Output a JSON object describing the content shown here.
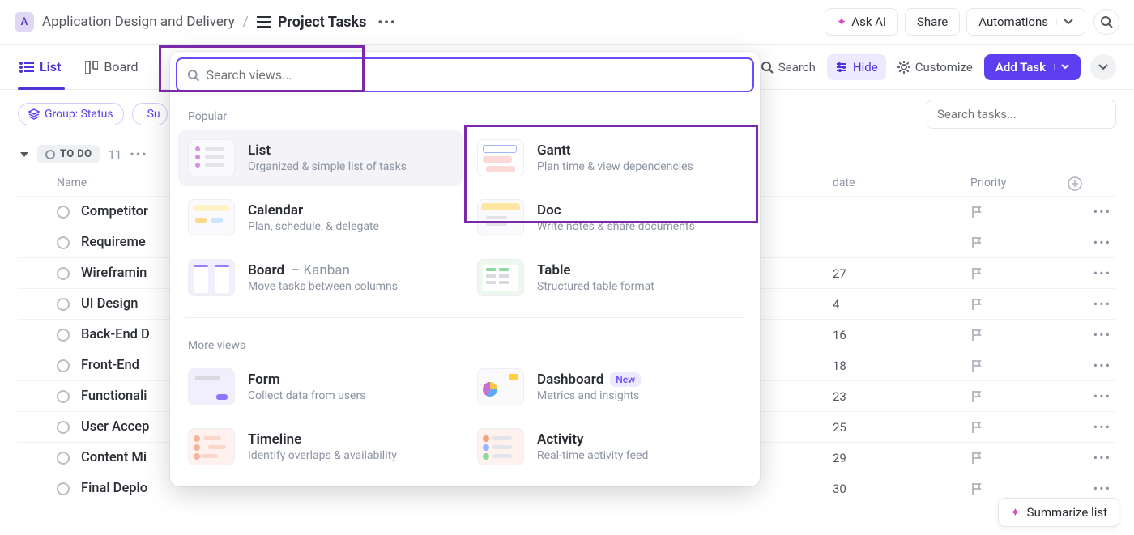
{
  "header": {
    "workspace_badge": "A",
    "folder": "Application Design and Delivery",
    "title": "Project Tasks",
    "ask_ai": "Ask AI",
    "share": "Share",
    "automations": "Automations"
  },
  "viewbar": {
    "tabs": [
      {
        "label": "List",
        "key": "list",
        "active": true
      },
      {
        "label": "Board",
        "key": "board",
        "active": false
      }
    ],
    "search_label": "Search",
    "hide_label": "Hide",
    "customize_label": "Customize",
    "add_task": "Add Task"
  },
  "filters": {
    "group_chip": "Group: Status",
    "subtasks_chip_prefix": "Su",
    "search_placeholder": "Search tasks..."
  },
  "popup": {
    "search_placeholder": "Search views...",
    "sections": {
      "popular": "Popular",
      "more": "More views"
    },
    "popular": [
      {
        "title": "List",
        "sub": "Organized & simple list of tasks",
        "thumb": "th-list",
        "selected": true
      },
      {
        "title": "Gantt",
        "sub": "Plan time & view dependencies",
        "thumb": "th-gantt"
      },
      {
        "title": "Calendar",
        "sub": "Plan, schedule, & delegate",
        "thumb": "th-cal"
      },
      {
        "title": "Doc",
        "sub": "Write notes & share documents",
        "thumb": "th-doc"
      },
      {
        "title": "Board",
        "suffix": " – Kanban",
        "sub": "Move tasks between columns",
        "thumb": "th-board"
      },
      {
        "title": "Table",
        "sub": "Structured table format",
        "thumb": "th-table"
      }
    ],
    "more": [
      {
        "title": "Form",
        "sub": "Collect data from users",
        "thumb": "th-form"
      },
      {
        "title": "Dashboard",
        "badge": "New",
        "sub": "Metrics and insights",
        "thumb": "th-dash"
      },
      {
        "title": "Timeline",
        "sub": "Identify overlaps & availability",
        "thumb": "th-tl"
      },
      {
        "title": "Activity",
        "sub": "Real-time activity feed",
        "thumb": "th-act"
      }
    ]
  },
  "list": {
    "status_label": "TO DO",
    "status_count": "11",
    "columns": {
      "name": "Name",
      "date": "date",
      "priority": "Priority"
    },
    "rows": [
      {
        "name": "Competitor",
        "date": ""
      },
      {
        "name": "Requireme",
        "date": ""
      },
      {
        "name": "Wireframin",
        "date": "27"
      },
      {
        "name": "UI Design",
        "date": "4"
      },
      {
        "name": "Back-End D",
        "date": "16"
      },
      {
        "name": "Front-End",
        "date": "18"
      },
      {
        "name": "Functionali",
        "date": "23"
      },
      {
        "name": "User Accep",
        "date": "25"
      },
      {
        "name": "Content Mi",
        "date": "29"
      },
      {
        "name": "Final Deplo",
        "date": "30"
      }
    ]
  },
  "summarize": "Summarize list"
}
